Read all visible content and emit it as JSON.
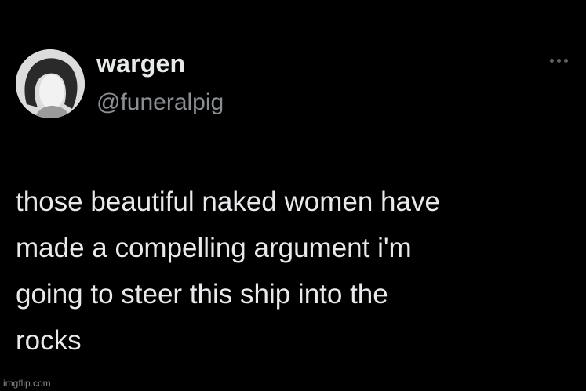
{
  "tweet": {
    "display_name": "wargen",
    "handle": "@funeralpig",
    "text": "those beautiful naked women have\nmade a compelling argument i'm\ngoing to steer this ship into the\nrocks",
    "more_icon": "ellipsis-icon",
    "avatar_icon": "profile-avatar"
  },
  "watermark": "imgflip.com",
  "colors": {
    "background": "#000000",
    "text": "#e7e9ea",
    "secondary": "#8b8f93"
  }
}
